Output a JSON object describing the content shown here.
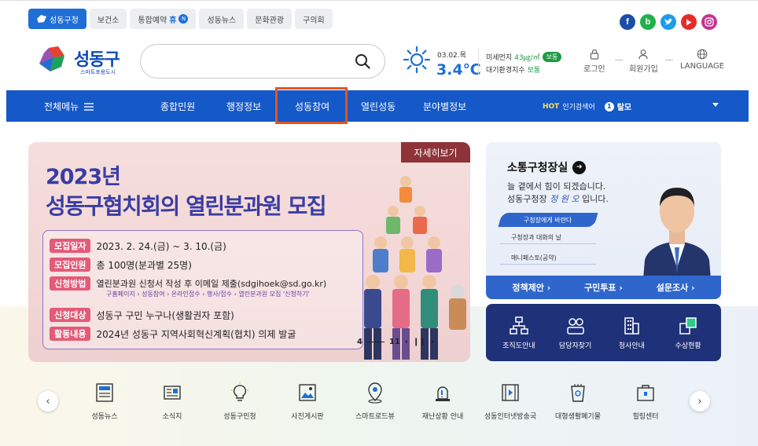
{
  "top_tabs": [
    "성동구청",
    "보건소",
    "통합예약",
    "성동뉴스",
    "문화관광",
    "구의회"
  ],
  "top_tab_badge": "휴",
  "socials": [
    {
      "name": "facebook",
      "glyph": "f",
      "color": "#1a4ea8"
    },
    {
      "name": "blog",
      "glyph": "b",
      "color": "#1fb24a"
    },
    {
      "name": "twitter",
      "glyph": "t",
      "color": "#1e9be9"
    },
    {
      "name": "youtube",
      "glyph": "▶",
      "color": "#e62b2b"
    },
    {
      "name": "instagram",
      "glyph": "◎",
      "color": "#c2358e"
    }
  ],
  "logo": {
    "text": "성동구",
    "subtitle": "스마트포용도시"
  },
  "search": {
    "placeholder": "",
    "value": ""
  },
  "weather": {
    "date": "03.02.목",
    "temp": "3.4℃"
  },
  "dust": {
    "label": "미세먼지",
    "value": "43㎍/㎥",
    "status": "보통",
    "air_label": "대기환경지수",
    "air_status": "보통"
  },
  "utility": {
    "login": "로그인",
    "signup": "회원가입",
    "language": "LANGUAGE"
  },
  "nav": {
    "all_menu": "전체메뉴",
    "items": [
      "종합민원",
      "행정정보",
      "성동참여",
      "열린성동",
      "분야별정보"
    ],
    "hot_label": "HOT",
    "hot_text": "인기검색어",
    "hot_rank": "1",
    "hot_word": "탈모"
  },
  "banner": {
    "title1": "2023년",
    "title2": "성동구협치회의 열린분과원 모집",
    "more": "자세히보기",
    "rows": [
      {
        "tag": "모집일자",
        "text": "2023. 2. 24.(금) ~ 3. 10.(금)"
      },
      {
        "tag": "모집인원",
        "text": "총 100명(분과별 25명)"
      },
      {
        "tag": "신청방법",
        "text": "열린분과원 신청서 작성 후 이메일 제출(sdgihoek@sd.go.kr)"
      },
      {
        "tag": "신청대상",
        "text": "성동구 구민 누구나(생활권자 포함)"
      },
      {
        "tag": "활동내용",
        "text": "2024년 성동구 지역사회혁신계획(협치) 의제 발굴"
      }
    ],
    "sub": "구홈페이지 › 성동참여 › 온라인접수 › 행사/접수 › 열린분과원 모집 '신청하기'",
    "pager": {
      "current": "4",
      "total": "11"
    }
  },
  "mayor": {
    "title": "소통구청장실",
    "line1": "늘 곁에서 힘이 되겠습니다.",
    "line2_pre": "성동구청장",
    "line2_sig": "정 원 오",
    "line2_post": "입니다.",
    "btn": "구청장에게 바란다",
    "link1": "구청장과 대화의 날",
    "link2": "매니페스토(공약)",
    "bar": [
      "정책제안 ›",
      "구민투표 ›",
      "설문조사 ›"
    ]
  },
  "dept": [
    "조직도안내",
    "담당자찾기",
    "청사안내",
    "수상현황"
  ],
  "quick": [
    "성동뉴스",
    "소식지",
    "성동구민청",
    "사진게시판",
    "스마트로드뷰",
    "재난상황 안내",
    "성동인터넷방송국",
    "대형생활폐기물",
    "힐링센터"
  ],
  "colors": {
    "primary": "#1558c8",
    "highlight": "#e8531e",
    "banner_title": "#3a3da3",
    "more_bg": "#8e3338",
    "tag": "#e45a78",
    "dept_bg": "#1f3178"
  }
}
